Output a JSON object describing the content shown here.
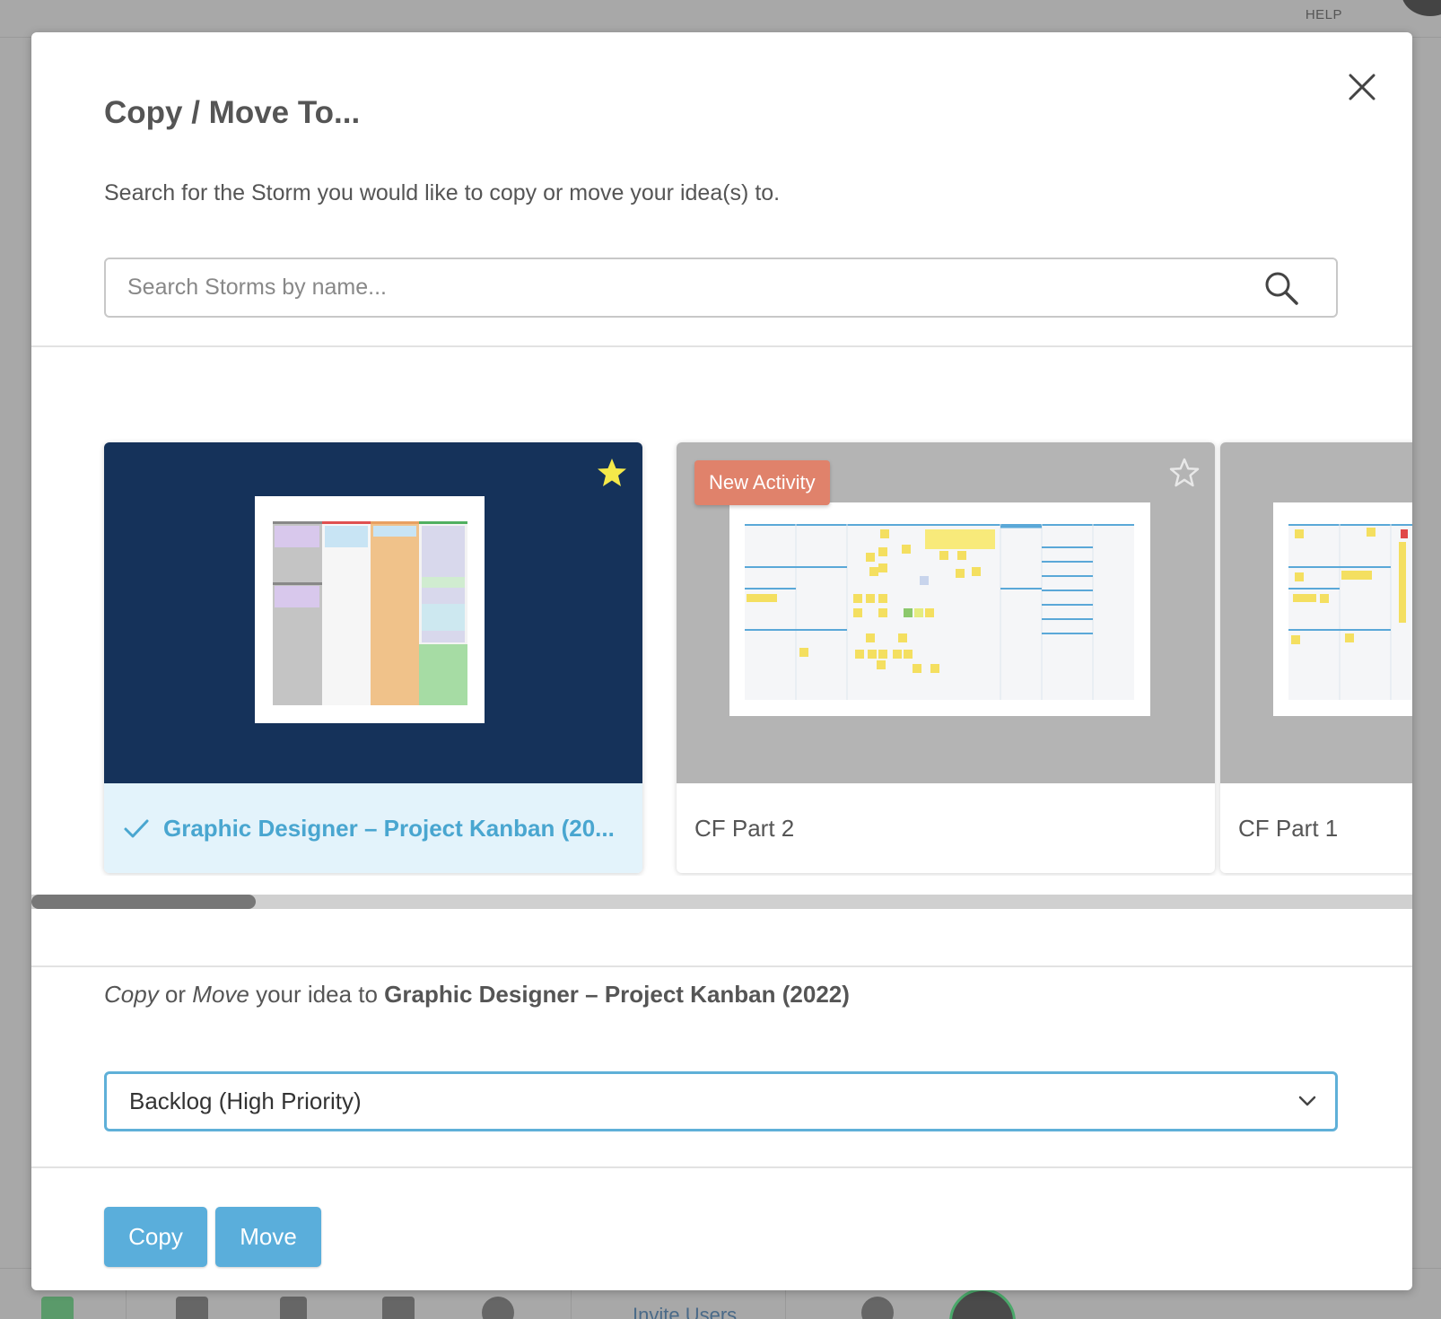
{
  "background": {
    "help_label": "HELP",
    "invite_label": "Invite Users"
  },
  "modal": {
    "title": "Copy / Move To...",
    "subtitle": "Search for the Storm you would like to copy or move your idea(s) to.",
    "search": {
      "placeholder": "Search Storms by name...",
      "value": ""
    },
    "storms": [
      {
        "name": "Graphic Designer – Project Kanban (2022)",
        "display_name": "Graphic Designer – Project Kanban (20...",
        "selected": true,
        "starred": true,
        "badge": ""
      },
      {
        "name": "CF Part 2",
        "display_name": "CF Part 2",
        "selected": false,
        "starred": false,
        "badge": "New Activity"
      },
      {
        "name": "CF Part 1",
        "display_name": "CF Part 1",
        "selected": false,
        "starred": false,
        "badge": ""
      }
    ],
    "target": {
      "copy_word": "Copy",
      "or_word": " or ",
      "move_word": "Move",
      "mid_text": " your idea to ",
      "storm_name": "Graphic Designer – Project Kanban (2022)"
    },
    "section_select": {
      "selected": "Backlog (High Priority)"
    },
    "buttons": {
      "copy_label": "Copy",
      "move_label": "Move"
    }
  },
  "colors": {
    "accent": "#5aaedb",
    "selected_thumb_bg": "#15325a",
    "badge": "#e0826b",
    "star_active": "#f5e94a"
  }
}
